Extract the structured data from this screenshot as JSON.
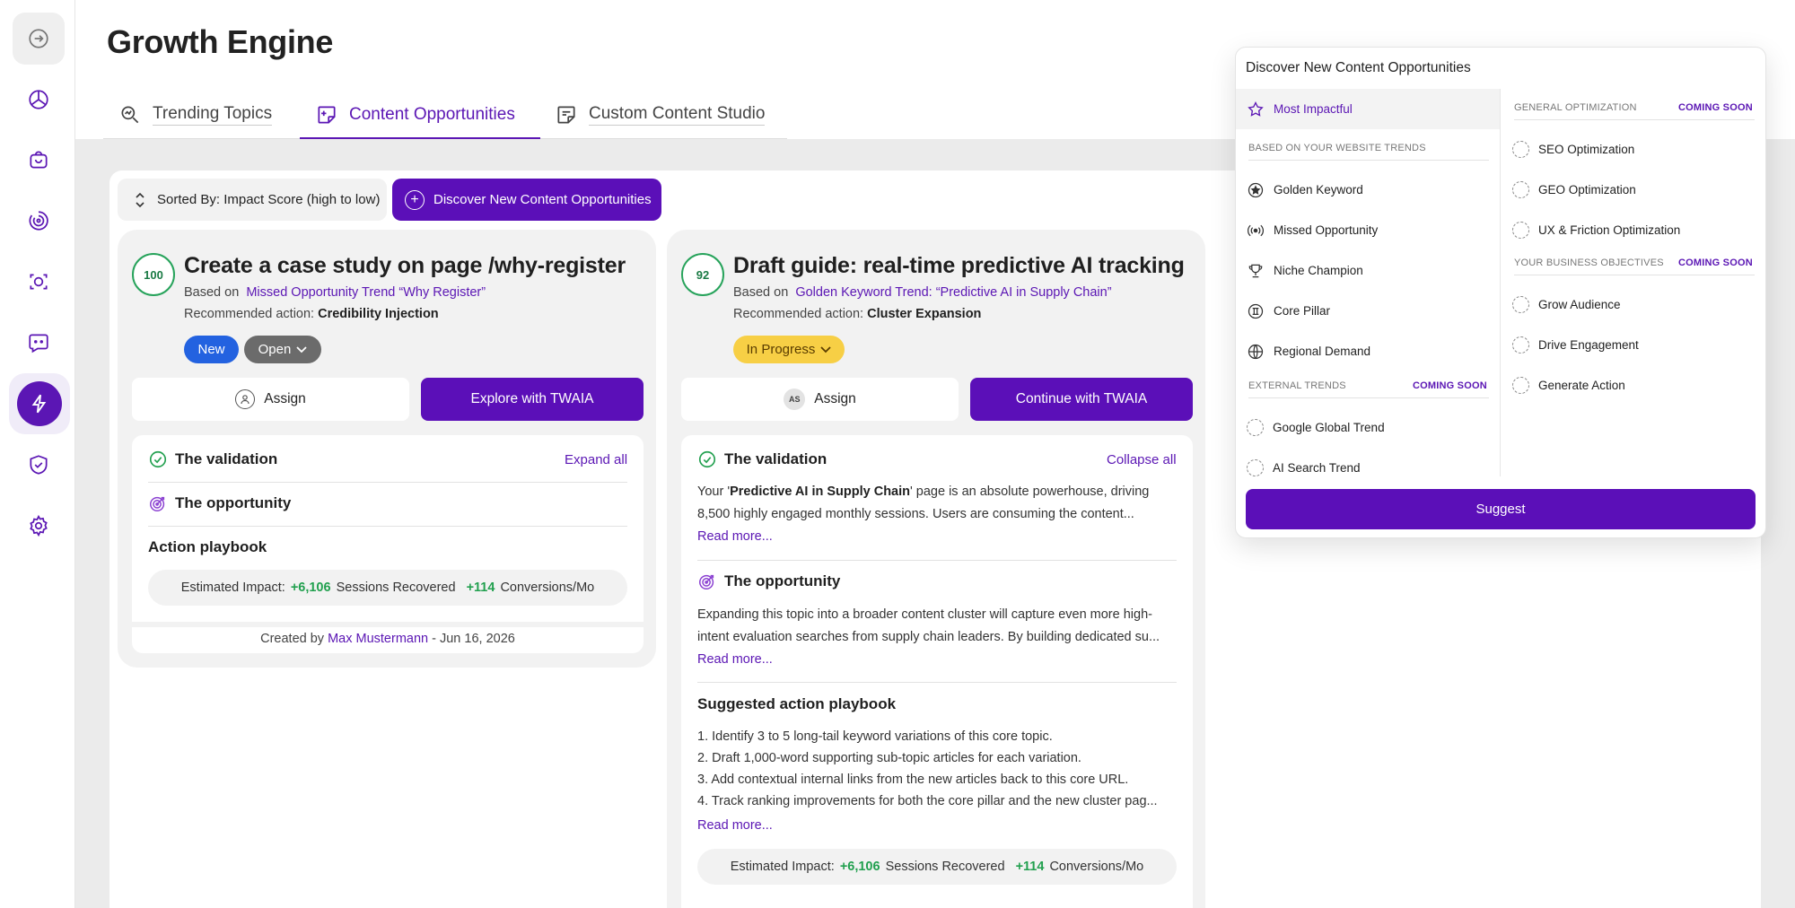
{
  "header": {
    "title": "Growth Engine"
  },
  "tabs": [
    {
      "label": "Trending Topics"
    },
    {
      "label": "Content Opportunities"
    },
    {
      "label": "Custom Content Studio"
    }
  ],
  "toolbar": {
    "sort_label": "Sorted By: Impact Score (high to low)",
    "discover_label": "Discover New Content Opportunities"
  },
  "cards": [
    {
      "score": "100",
      "title": "Create a case study on page /why-register",
      "based_prefix": "Based on",
      "based_link": "Missed Opportunity Trend “Why Register”",
      "rec_prefix": "Recommended action:",
      "rec_value": "Credibility Injection",
      "status_new": "New",
      "status_open": "Open",
      "assign_label": "Assign",
      "primary_label": "Explore with TWAIA",
      "validation_label": "The validation",
      "expand_label": "Expand all",
      "opportunity_label": "The opportunity",
      "playbook_label": "Action playbook",
      "impact": {
        "prefix": "Estimated Impact:",
        "sessions_value": "+6,106",
        "sessions_label": "Sessions Recovered",
        "conv_value": "+114",
        "conv_label": "Conversions/Mo"
      },
      "created_prefix": "Created by",
      "created_by": "Max Mustermann",
      "created_date": "- Jun 16, 2026"
    },
    {
      "score": "92",
      "title": "Draft guide: real-time predictive AI tracking",
      "based_prefix": "Based on",
      "based_link": "Golden Keyword Trend: “Predictive AI in Supply Chain”",
      "rec_prefix": "Recommended action:",
      "rec_value": "Cluster Expansion",
      "status_progress": "In Progress",
      "assign_initials": "AS",
      "assign_label": "Assign",
      "primary_label": "Continue with TWAIA",
      "validation_label": "The validation",
      "collapse_label": "Collapse all",
      "validation_text_pre": "Your '",
      "validation_text_bold": "Predictive AI in Supply Chain",
      "validation_text_post": "' page is an absolute powerhouse, driving 8,500 highly engaged monthly sessions. Users are consuming the content...",
      "read_more": "Read more...",
      "opportunity_label": "The opportunity",
      "opportunity_text": "Expanding this topic into a broader content cluster will capture even more high-intent evaluation searches from supply chain leaders. By building dedicated su...",
      "playbook_label": "Suggested action playbook",
      "playbook_steps": [
        "1.  Identify 3 to 5 long-tail keyword variations of this core topic.",
        "2.  Draft 1,000-word supporting sub-topic articles for each variation.",
        "3.  Add contextual internal links from the new articles back to this core URL.",
        "4.  Track ranking improvements for both the core pillar and the new cluster pag..."
      ],
      "impact": {
        "prefix": "Estimated Impact:",
        "sessions_value": "+6,106",
        "sessions_label": "Sessions Recovered",
        "conv_value": "+114",
        "conv_label": "Conversions/Mo"
      }
    }
  ],
  "dropdown": {
    "title": "Discover New Content Opportunities",
    "most_impactful": "Most Impactful",
    "website_trends_caption": "BASED ON YOUR WEBSITE TRENDS",
    "website_trends": [
      "Golden Keyword",
      "Missed Opportunity",
      "Niche Champion",
      "Core Pillar",
      "Regional Demand"
    ],
    "external_caption": "EXTERNAL TRENDS",
    "external_soon": "COMING SOON",
    "external_items": [
      "Google Global Trend",
      "AI Search Trend"
    ],
    "general_caption": "GENERAL OPTIMIZATION",
    "general_soon": "COMING SOON",
    "general_items": [
      "SEO Optimization",
      "GEO Optimization",
      "UX & Friction Optimization"
    ],
    "business_caption": "YOUR BUSINESS OBJECTIVES",
    "business_soon": "COMING SOON",
    "business_items": [
      "Grow Audience",
      "Drive Engagement",
      "Generate Action"
    ],
    "suggest_label": "Suggest"
  },
  "colors": {
    "accent": "#5b0fb8",
    "success": "#22a04f",
    "new_badge": "#2362e0",
    "progress_badge": "#f7cf45"
  }
}
